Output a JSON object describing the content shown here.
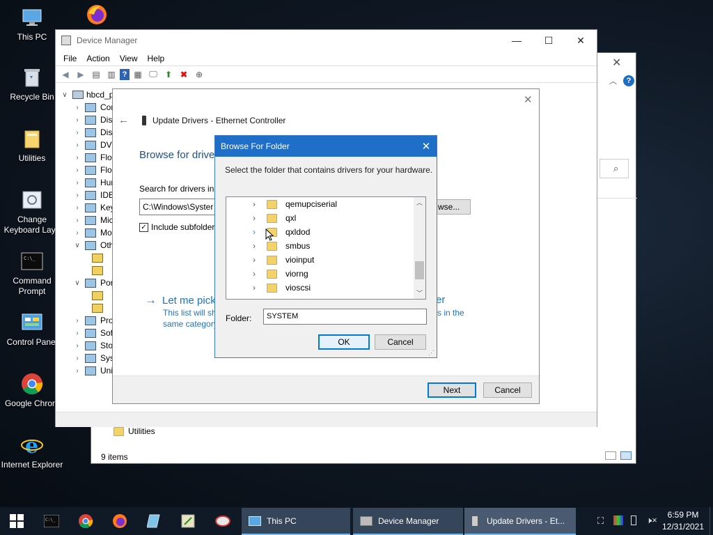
{
  "desktop": {
    "icons": [
      {
        "label": "This PC",
        "icon": "computer-icon"
      },
      {
        "label": "",
        "icon": "firefox-icon"
      },
      {
        "label": "Recycle Bin",
        "icon": "recycle-bin-icon"
      },
      {
        "label": "Utilities",
        "icon": "folder-icon"
      },
      {
        "label": "Change Keyboard Layo",
        "icon": "keyboard-icon"
      },
      {
        "label": "Command Prompt",
        "icon": "terminal-icon"
      },
      {
        "label": "Control Panel",
        "icon": "control-panel-icon"
      },
      {
        "label": "Google Chrom",
        "icon": "chrome-icon"
      },
      {
        "label": "Internet Explorer",
        "icon": "ie-icon"
      }
    ]
  },
  "explorer_bg": {
    "status": "9 items",
    "list_item": "Utilities"
  },
  "device_manager": {
    "title": "Device Manager",
    "menu": [
      "File",
      "Action",
      "View",
      "Help"
    ],
    "root": "hbcd_p",
    "tree": [
      "Cor",
      "Disk",
      "Disp",
      "DVD",
      "Flop",
      "Flop",
      "Hur",
      "IDE",
      "Key",
      "Mic",
      "Mo",
      "Oth",
      "",
      "",
      "Por",
      "",
      "",
      "Pro",
      "Soft",
      "Stor",
      "Syst",
      "Uni"
    ]
  },
  "update_wizard": {
    "title": "Update Drivers - Ethernet Controller",
    "heading": "Browse for drive",
    "search_label": "Search for drivers in t",
    "path_value": "C:\\Windows\\Syster",
    "browse_label": "wse...",
    "include_subfolders": "Include subfolder",
    "let_me_pick": "Let me pick",
    "let_me_pick_suffix": "er",
    "list_desc_1": "This list will sh",
    "list_desc_1b": "rs in the",
    "list_desc_2": "same category",
    "next": "Next",
    "cancel": "Cancel"
  },
  "browse_dialog": {
    "title": "Browse For Folder",
    "instruction": "Select the folder that contains drivers for your hardware.",
    "folders": [
      "qemupciserial",
      "qxl",
      "qxldod",
      "smbus",
      "vioinput",
      "viorng",
      "vioscsi"
    ],
    "folder_label": "Folder:",
    "folder_value": "SYSTEM",
    "ok": "OK",
    "cancel": "Cancel"
  },
  "taskbar": {
    "windows": [
      "This PC",
      "Device Manager",
      "Update Drivers - Et..."
    ],
    "time": "6:59 PM",
    "date": "12/31/2021"
  },
  "colors": {
    "accent": "#0078d7",
    "link": "#1a73c8",
    "taskbar": "#101a27"
  }
}
